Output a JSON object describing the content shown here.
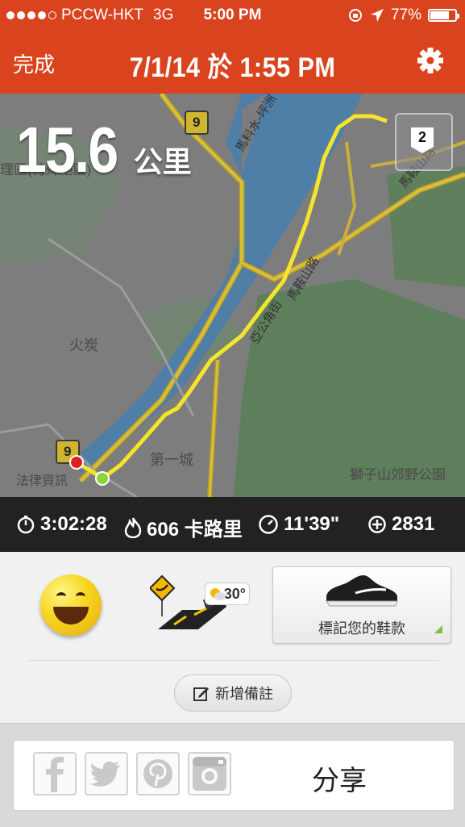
{
  "status_bar": {
    "carrier": "PCCW-HKT",
    "network": "3G",
    "time": "5:00 PM",
    "battery": "77%",
    "battery_level": 0.77
  },
  "nav": {
    "done_label": "完成",
    "title": "7/1/14 於 1:55 PM",
    "settings_icon": "gear-icon"
  },
  "run": {
    "distance_value": "15.6",
    "distance_unit": "公里",
    "lap_badge": "2"
  },
  "map_labels": {
    "road_number_top": "9",
    "road_number_bottom": "9",
    "area_left": "理區(特殊地區)",
    "fo_tan": "火炭",
    "first_city": "第一城",
    "lion_rock": "獅子山郊野公園",
    "law_firm": "法律資訊",
    "ma_on_shan_road": "馬鞍山路",
    "ma_on_shan_road_2": "馬鞍山路",
    "road_diag_top": "馬料水-坪洲",
    "road_diag_mid": "亞公角街"
  },
  "stats": {
    "duration": "3:02:28",
    "calories": "606 卡路里",
    "pace": "11'39\"",
    "fuel": "2831"
  },
  "details": {
    "mood_icon": "smiley-icon",
    "terrain_icon": "road-icon",
    "temperature": "30°",
    "shoe_label": "標記您的鞋款",
    "add_note_label": "新增備註"
  },
  "share": {
    "label": "分享",
    "icons": [
      "facebook-icon",
      "twitter-icon",
      "pinterest-icon",
      "instagram-icon"
    ]
  },
  "colors": {
    "accent": "#d9441f",
    "route": "#f5e52a",
    "stats_bg": "#222222"
  }
}
